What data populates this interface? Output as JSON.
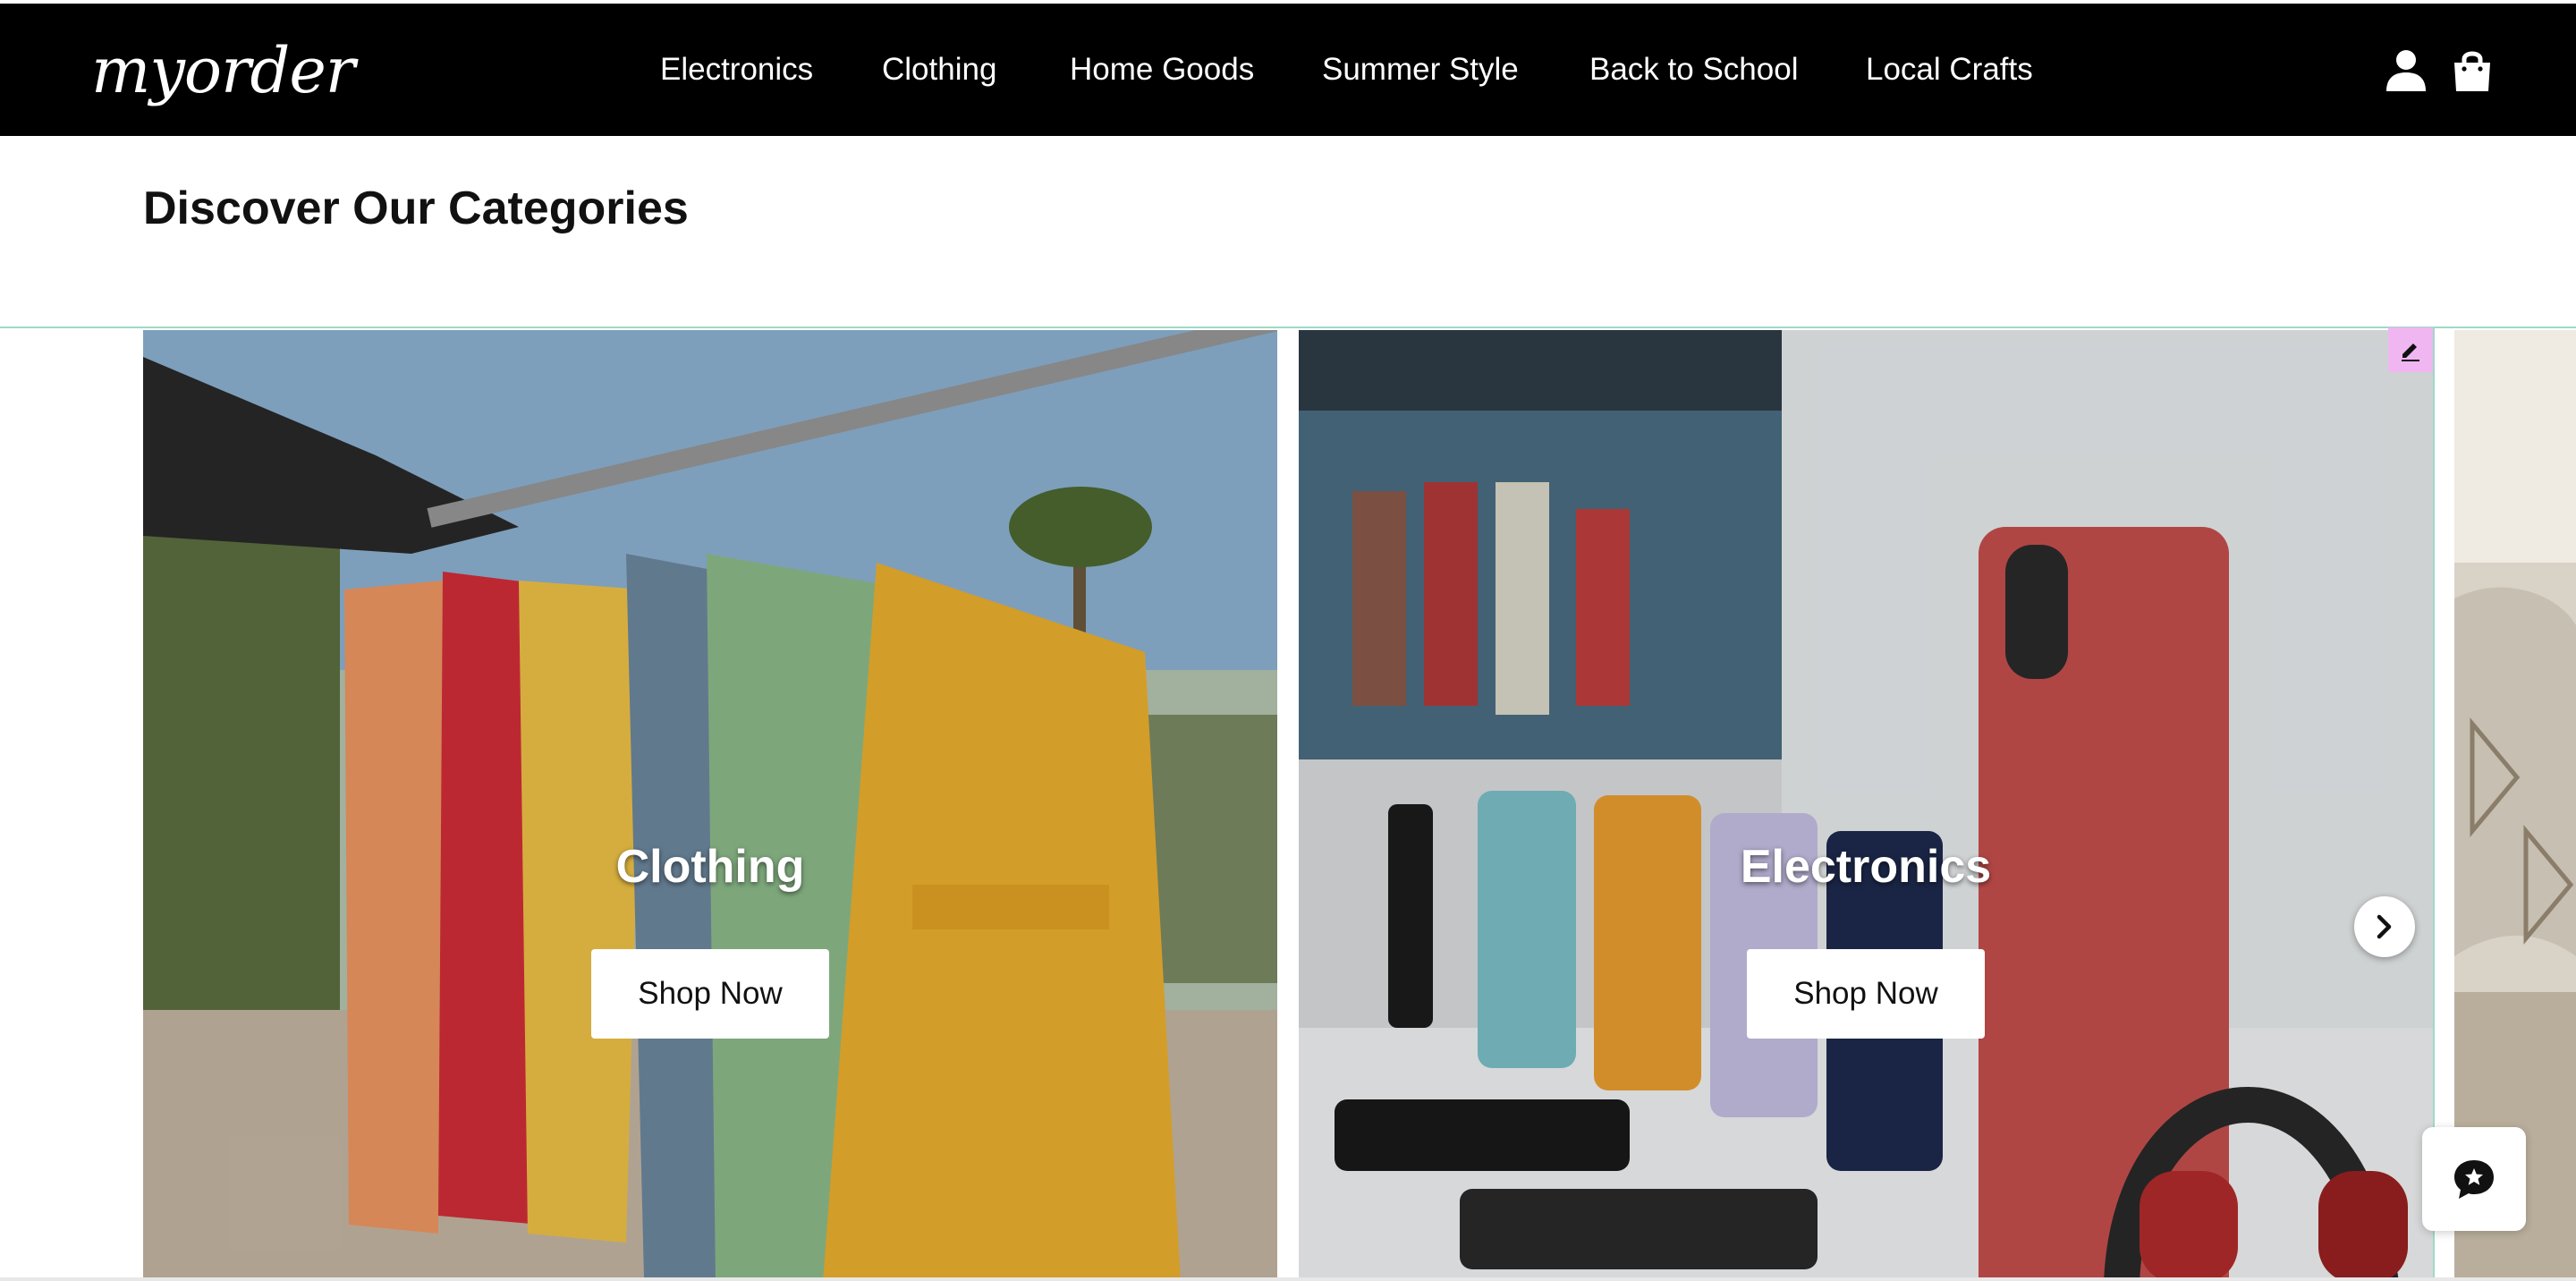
{
  "header": {
    "logo": "myorder",
    "nav": [
      {
        "label": "Electronics"
      },
      {
        "label": "Clothing"
      },
      {
        "label": "Home Goods"
      },
      {
        "label": "Summer Style"
      },
      {
        "label": "Back to School"
      },
      {
        "label": "Local Crafts"
      }
    ],
    "icons": [
      "user-icon",
      "shopping-bag-icon"
    ]
  },
  "main": {
    "title": "Discover Our Categories",
    "cards": [
      {
        "title": "Clothing",
        "button": "Shop Now",
        "image": "dresses-on-clothes-rack-photo"
      },
      {
        "title": "Electronics",
        "button": "Shop Now",
        "image": "phones-and-headphones-display-photo"
      },
      {
        "image": "home-goods-cushions-photo"
      }
    ]
  },
  "controls": {
    "next_icon": "chevron-right-icon",
    "edit_icon": "pencil-icon",
    "chat_icon": "chat-bubble-icon"
  },
  "colors": {
    "header_bg": "#000000",
    "carousel_border": "#9fd9c8",
    "edit_badge_bg": "#f0b6f2"
  }
}
